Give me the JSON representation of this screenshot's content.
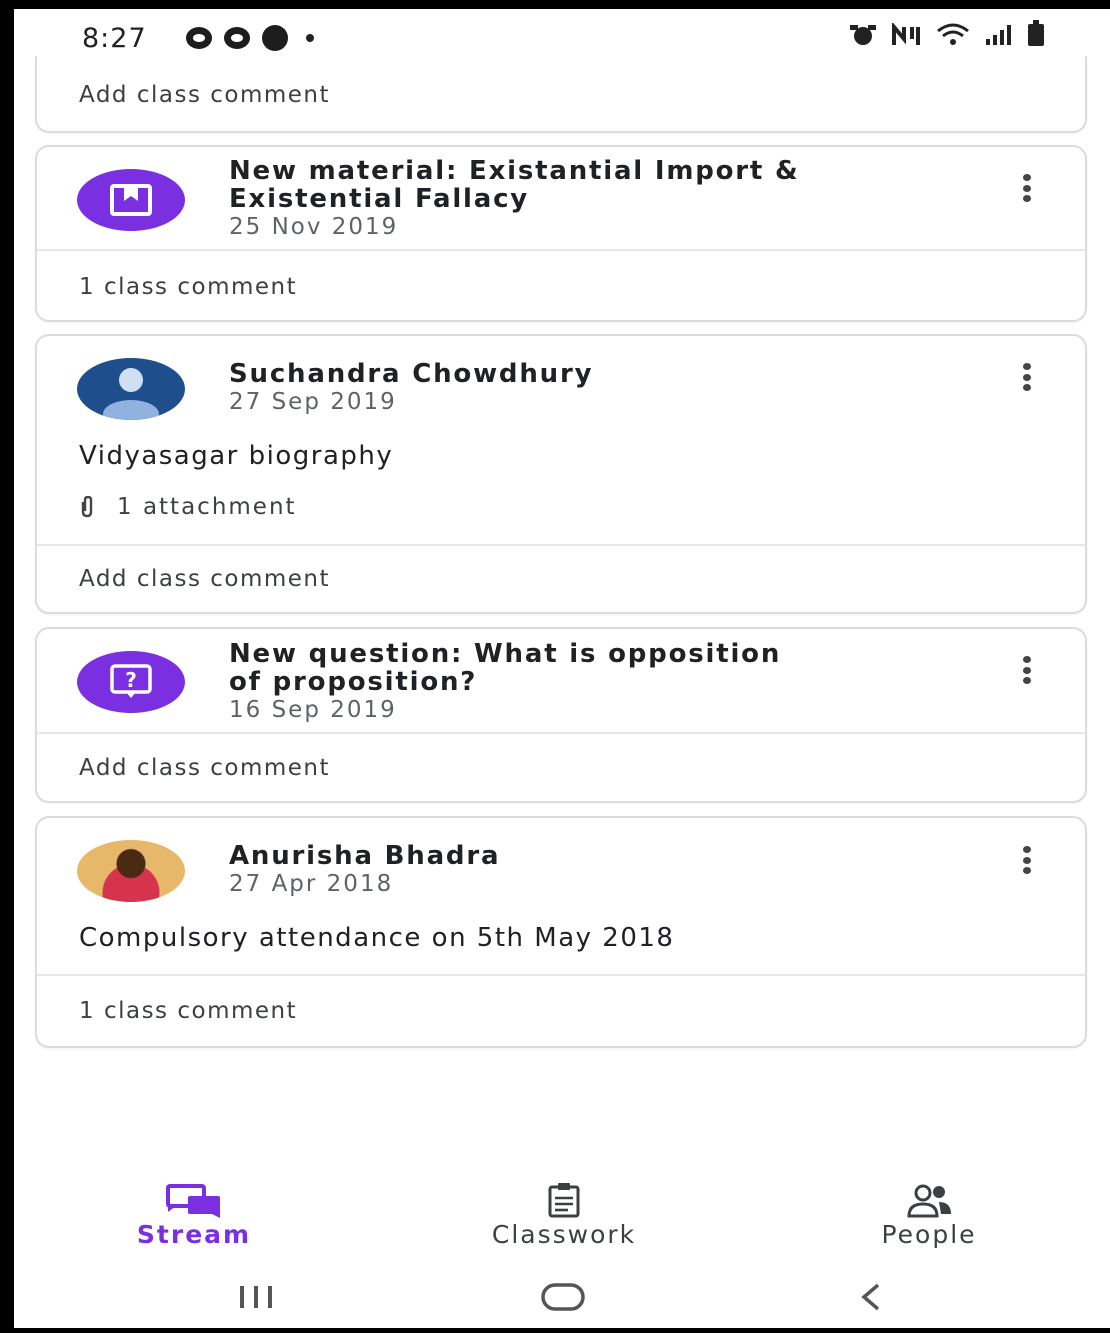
{
  "status_bar": {
    "time": "8:27"
  },
  "posts": [
    {
      "type": "partial",
      "comment": "Add class comment"
    },
    {
      "type": "material",
      "icon": "material-icon",
      "title_line1": "New material: Existantial Import &",
      "title_line2": "Existential Fallacy",
      "date": "25 Nov 2019",
      "comment": "1 class comment"
    },
    {
      "type": "announcement",
      "author": "Suchandra Chowdhury",
      "date": "27 Sep 2019",
      "body": "Vidyasagar biography",
      "attachment": "1 attachment",
      "comment": "Add class comment"
    },
    {
      "type": "question",
      "icon": "question-icon",
      "title_line1": "New question: What is opposition",
      "title_line2": "of proposition?",
      "date": "16 Sep 2019",
      "comment": "Add class comment"
    },
    {
      "type": "announcement",
      "author": "Anurisha Bhadra",
      "date": "27 Apr 2018",
      "body": "Compulsory attendance on 5th May 2018",
      "comment": "1 class comment"
    }
  ],
  "bottom_nav": {
    "items": [
      {
        "label": "Stream",
        "icon": "stream-icon",
        "active": true
      },
      {
        "label": "Classwork",
        "icon": "classwork-icon",
        "active": false
      },
      {
        "label": "People",
        "icon": "people-icon",
        "active": false
      }
    ]
  },
  "colors": {
    "accent": "#7a2fe0",
    "text": "#202124",
    "secondary_text": "#5f6368",
    "border": "#dadce0"
  }
}
